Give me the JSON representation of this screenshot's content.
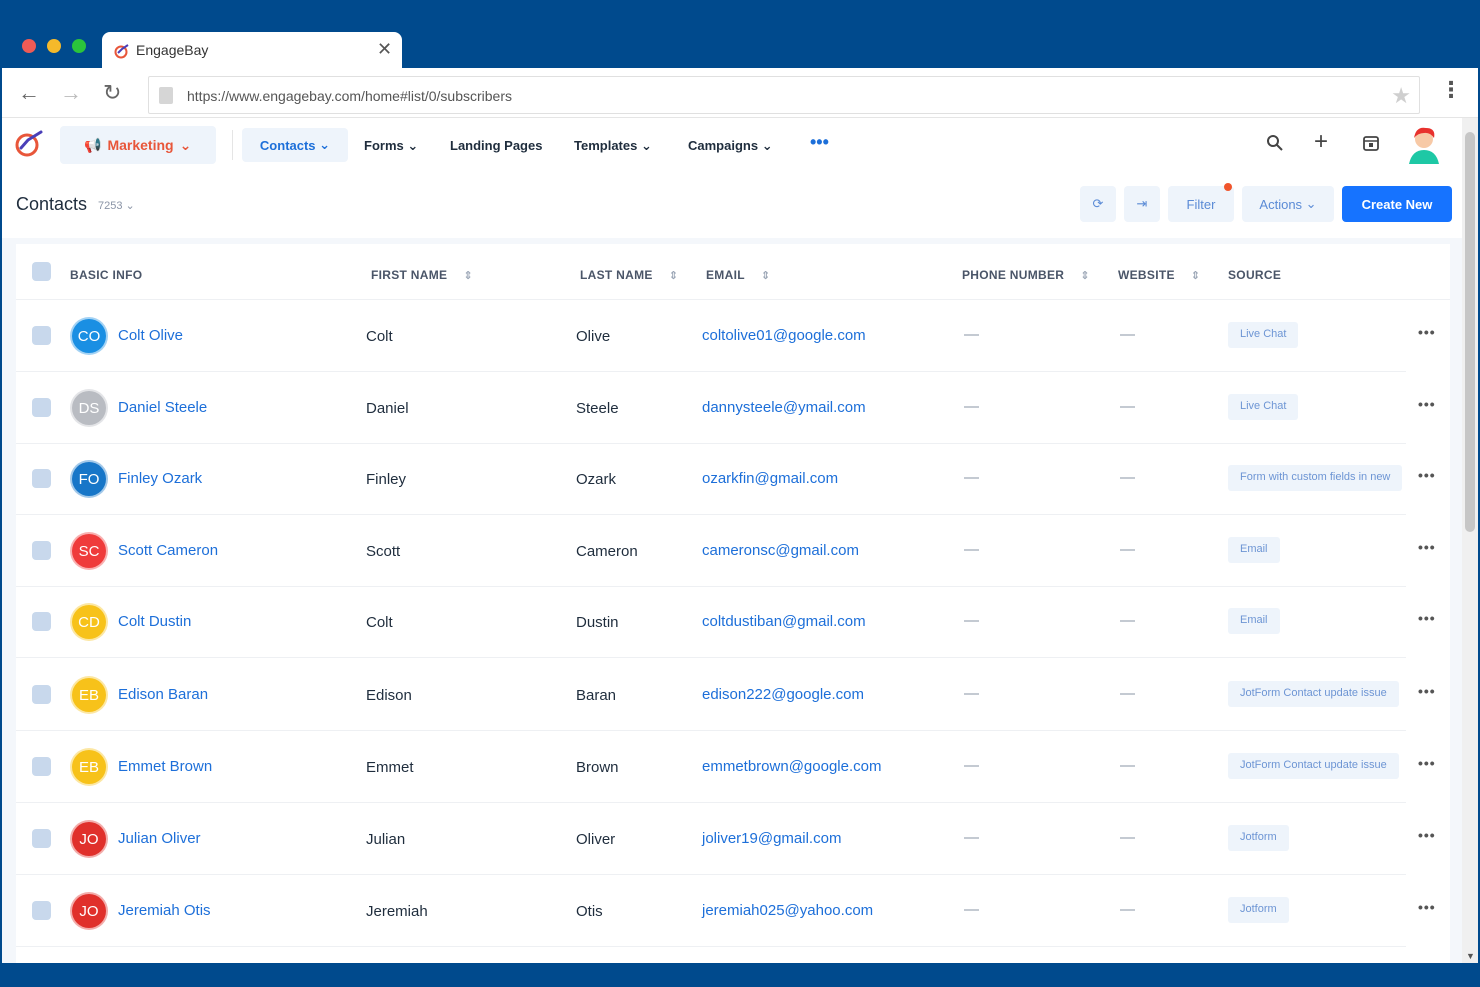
{
  "browser": {
    "tab_title": "EngageBay",
    "tab_close": "✕",
    "url": "https://www.engagebay.com/home#list/0/subscribers"
  },
  "nav": {
    "marketing": "Marketing",
    "contacts": "Contacts",
    "forms": "Forms",
    "landing_pages": "Landing Pages",
    "templates": "Templates",
    "campaigns": "Campaigns",
    "more": "•••"
  },
  "header": {
    "title": "Contacts",
    "count": "7253",
    "filter": "Filter",
    "actions": "Actions",
    "create_new": "Create New"
  },
  "table": {
    "columns": {
      "basic_info": "BASIC INFO",
      "first_name": "FIRST NAME",
      "last_name": "LAST NAME",
      "email": "EMAIL",
      "phone": "PHONE NUMBER",
      "website": "WEBSITE",
      "source": "SOURCE"
    },
    "rows": [
      {
        "initials": "CO",
        "color": "#1a8fe3",
        "name": "Colt Olive",
        "first": "Colt",
        "last": "Olive",
        "email": "coltolive01@google.com",
        "phone": "—",
        "website": "—",
        "source": "Live Chat"
      },
      {
        "initials": "DS",
        "color": "#b9bcc2",
        "name": "Daniel Steele",
        "first": "Daniel",
        "last": "Steele",
        "email": "dannysteele@ymail.com",
        "phone": "—",
        "website": "—",
        "source": "Live Chat"
      },
      {
        "initials": "FO",
        "color": "#1776c8",
        "name": "Finley Ozark",
        "first": "Finley",
        "last": "Ozark",
        "email": "ozarkfin@gmail.com",
        "phone": "—",
        "website": "—",
        "source": "Form with custom fields in new"
      },
      {
        "initials": "SC",
        "color": "#ef3b3b",
        "name": "Scott Cameron",
        "first": "Scott",
        "last": "Cameron",
        "email": "cameronsc@gmail.com",
        "phone": "—",
        "website": "—",
        "source": "Email"
      },
      {
        "initials": "CD",
        "color": "#f7c21a",
        "name": "Colt Dustin",
        "first": "Colt",
        "last": "Dustin",
        "email": "coltdustiban@gmail.com",
        "phone": "—",
        "website": "—",
        "source": "Email"
      },
      {
        "initials": "EB",
        "color": "#f7c21a",
        "name": "Edison Baran",
        "first": "Edison",
        "last": "Baran",
        "email": "edison222@google.com",
        "phone": "—",
        "website": "—",
        "source": "JotForm Contact update issue"
      },
      {
        "initials": "EB",
        "color": "#f7c21a",
        "name": "Emmet Brown",
        "first": "Emmet",
        "last": "Brown",
        "email": "emmetbrown@google.com",
        "phone": "—",
        "website": "—",
        "source": "JotForm Contact update issue"
      },
      {
        "initials": "JO",
        "color": "#e0302b",
        "name": "Julian Oliver",
        "first": "Julian",
        "last": "Oliver",
        "email": "joliver19@gmail.com",
        "phone": "—",
        "website": "—",
        "source": "Jotform"
      },
      {
        "initials": "JO",
        "color": "#e0302b",
        "name": "Jeremiah Otis",
        "first": "Jeremiah",
        "last": "Otis",
        "email": "jeremiah025@yahoo.com",
        "phone": "—",
        "website": "—",
        "source": "Jotform"
      }
    ]
  },
  "icons": {
    "back": "arrow-left-icon",
    "forward": "arrow-right-icon",
    "reload": "reload-icon",
    "star": "star-icon",
    "search": "search-icon",
    "add": "plus-icon",
    "calendar": "calendar-icon",
    "refresh": "refresh-icon",
    "export": "export-icon"
  },
  "colors": {
    "brand_blue": "#1673ff",
    "frame": "#004a8d",
    "marketing_accent": "#e8563a"
  }
}
